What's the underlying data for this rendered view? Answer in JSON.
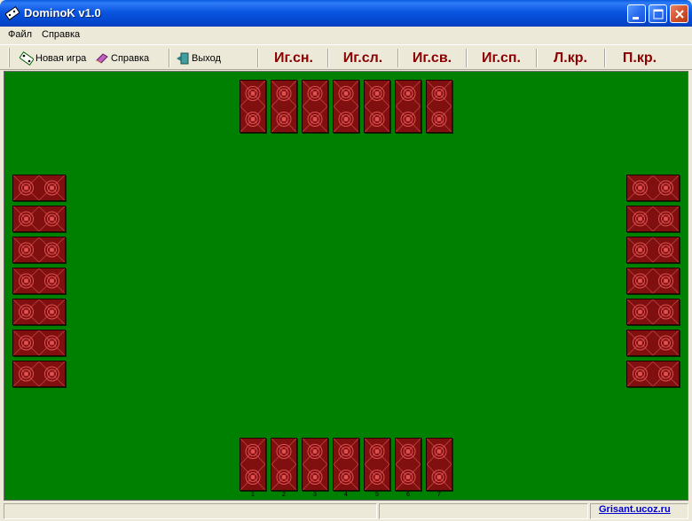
{
  "window": {
    "title": "DominoK v1.0"
  },
  "menu": {
    "file": "Файл",
    "help": "Справка"
  },
  "toolbar": {
    "new_game": "Новая игра",
    "help": "Справка",
    "exit": "Выход",
    "buttons": [
      "Иг.сн.",
      "Иг.сл.",
      "Иг.св.",
      "Иг.сп.",
      "Л.кр.",
      "П.кр."
    ]
  },
  "hand_numbers": [
    "1",
    "2",
    "3",
    "4",
    "5",
    "6",
    "7"
  ],
  "status": {
    "link": "Grisant.ucoz.ru"
  },
  "colors": {
    "felt": "#008000",
    "tile_back": "#801010",
    "button_text": "#8b0000"
  }
}
